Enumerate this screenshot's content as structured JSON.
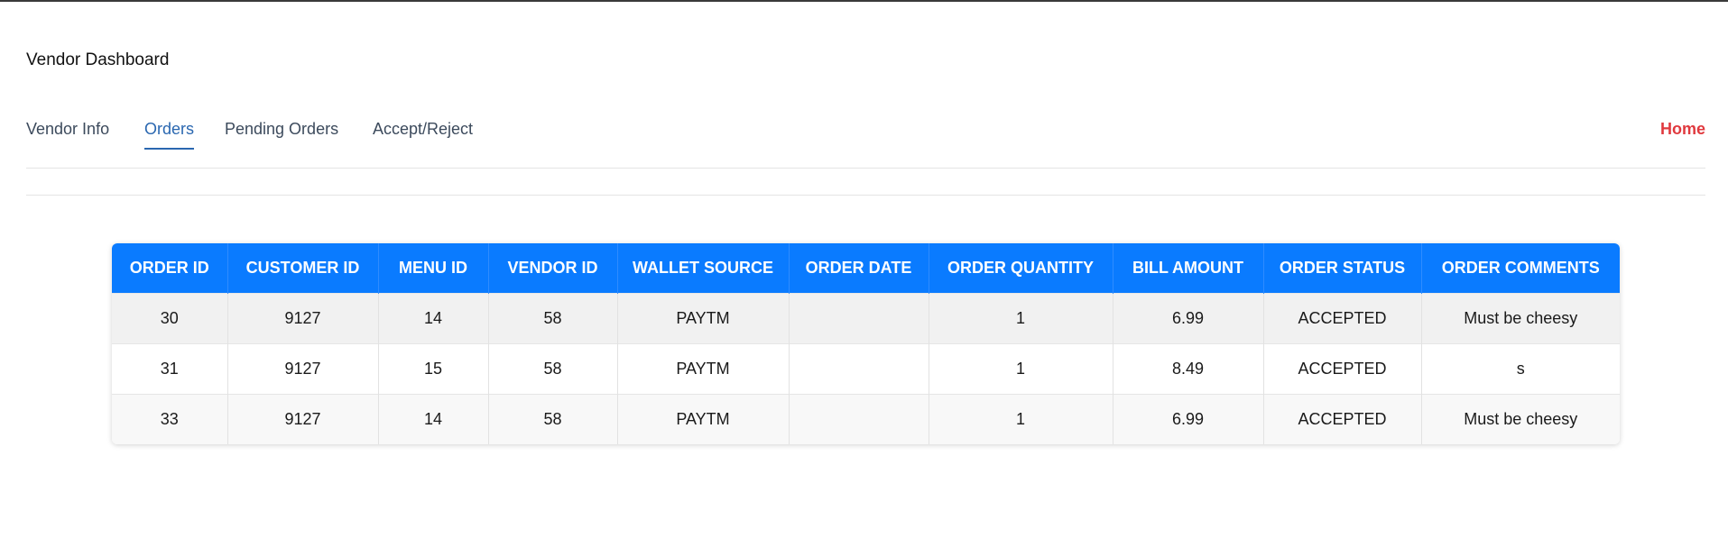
{
  "header": {
    "title": "Vendor Dashboard"
  },
  "nav": {
    "tabs": [
      {
        "label": "Vendor Info",
        "active": false
      },
      {
        "label": "Orders",
        "active": true
      },
      {
        "label": "Pending Orders",
        "active": false
      },
      {
        "label": "Accept/Reject",
        "active": false
      }
    ],
    "home_label": "Home"
  },
  "orders_table": {
    "columns": [
      "ORDER ID",
      "CUSTOMER ID",
      "MENU ID",
      "VENDOR ID",
      "WALLET SOURCE",
      "ORDER DATE",
      "ORDER QUANTITY",
      "BILL AMOUNT",
      "ORDER STATUS",
      "ORDER COMMENTS"
    ],
    "rows": [
      [
        "30",
        "9127",
        "14",
        "58",
        "PAYTM",
        "",
        "1",
        "6.99",
        "ACCEPTED",
        "Must be cheesy"
      ],
      [
        "31",
        "9127",
        "15",
        "58",
        "PAYTM",
        "",
        "1",
        "8.49",
        "ACCEPTED",
        "s"
      ],
      [
        "33",
        "9127",
        "14",
        "58",
        "PAYTM",
        "",
        "1",
        "6.99",
        "ACCEPTED",
        "Must be cheesy"
      ]
    ]
  },
  "colors": {
    "header_bg": "#0a7bff",
    "active_tab": "#2a67b0",
    "home_link": "#e0393e"
  }
}
